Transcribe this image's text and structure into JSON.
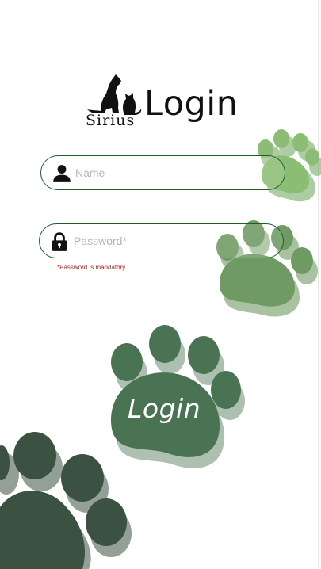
{
  "brand": {
    "logo_text": "Sirius",
    "logo_icon": "dog-and-cat-silhouette-icon"
  },
  "page": {
    "title": "Login"
  },
  "form": {
    "name": {
      "placeholder": "Name",
      "value": "",
      "icon": "person-icon"
    },
    "password": {
      "placeholder": "Password*",
      "value": "",
      "icon": "lock-icon"
    },
    "error": "*Password is mandatory"
  },
  "actions": {
    "login_label": "Login"
  },
  "colors": {
    "paw_light": "#8cbd74",
    "paw_mid": "#6f9a63",
    "paw_dark": "#4a7353",
    "paw_darkest": "#3b5243",
    "field_border": "#1f5e2a",
    "error": "#d61414"
  }
}
